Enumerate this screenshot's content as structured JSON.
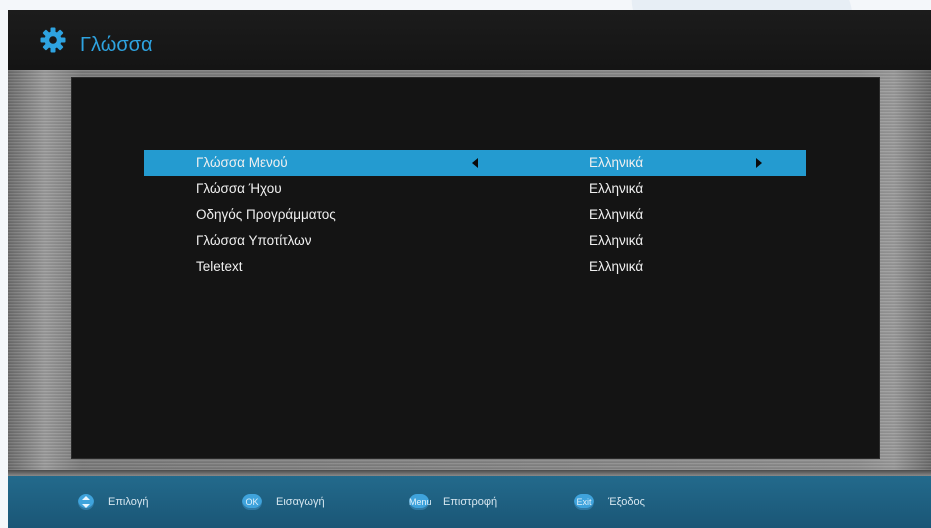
{
  "header": {
    "title": "Γλώσσα",
    "icon": "gear-icon"
  },
  "settings": [
    {
      "label": "Γλώσσα Μενού",
      "value": "Ελληνικά",
      "selected": true
    },
    {
      "label": "Γλώσσα Ήχου",
      "value": "Ελληνικά",
      "selected": false
    },
    {
      "label": "Οδηγός Προγράμματος",
      "value": "Ελληνικά",
      "selected": false
    },
    {
      "label": "Γλώσσα Υποτίτλων",
      "value": "Ελληνικά",
      "selected": false
    },
    {
      "label": "Teletext",
      "value": "Ελληνικά",
      "selected": false
    }
  ],
  "footer": {
    "hints": [
      {
        "key": "",
        "icon": "up-down-icon",
        "label": "Επιλογή"
      },
      {
        "key": "OK",
        "icon": "ok-button-icon",
        "label": "Εισαγωγή"
      },
      {
        "key": "Menu",
        "icon": "menu-button-icon",
        "label": "Επιστροφή"
      },
      {
        "key": "Exit",
        "icon": "exit-button-icon",
        "label": "Έξοδος"
      }
    ]
  },
  "colors": {
    "accent": "#2ea3e0",
    "selection": "#249bd0",
    "footer": "#1a5676"
  }
}
